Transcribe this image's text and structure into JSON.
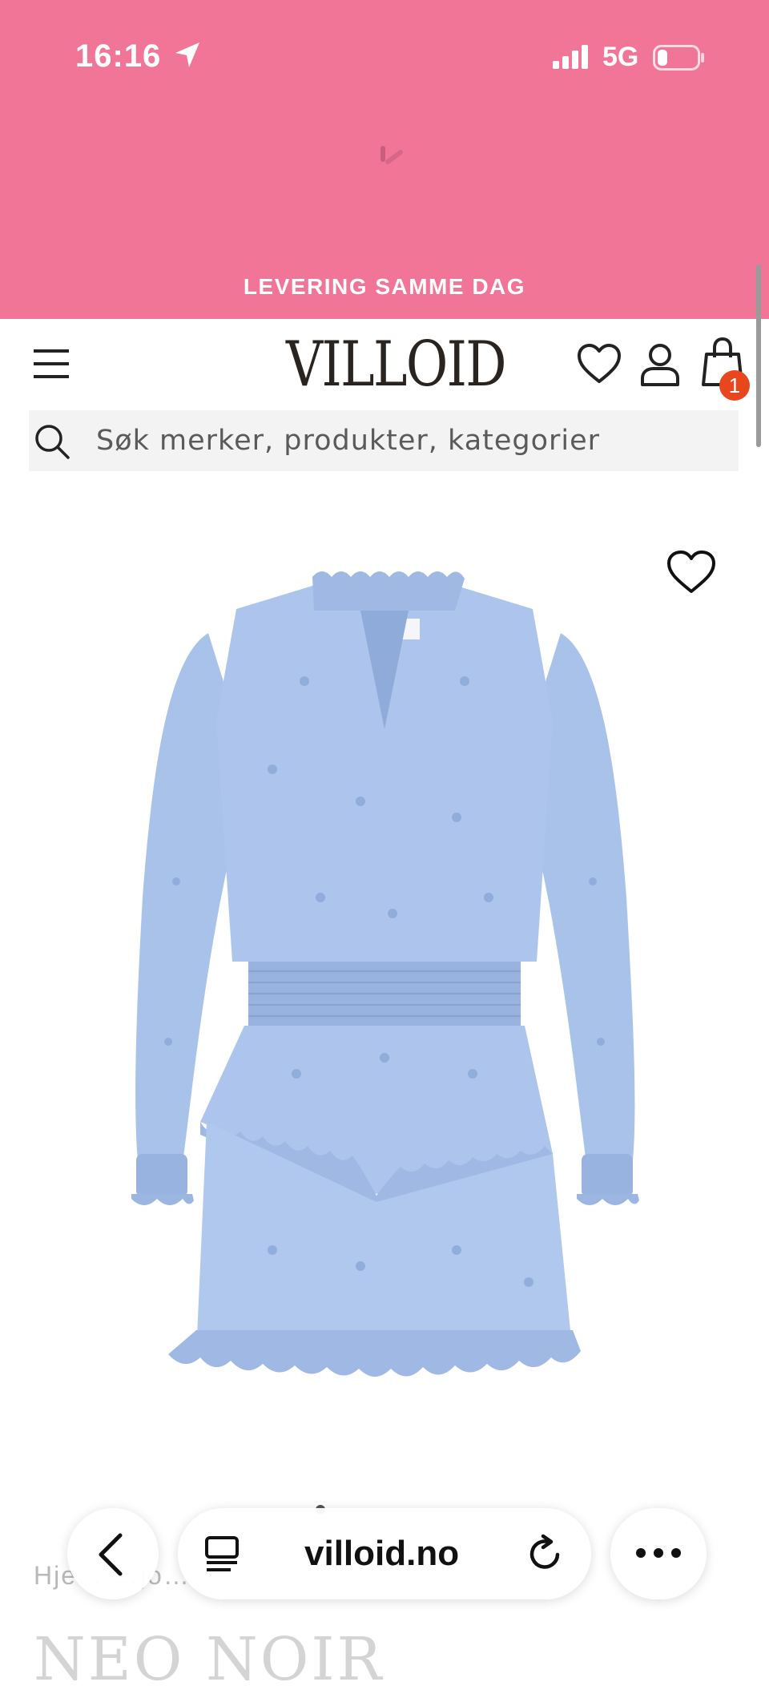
{
  "status_bar": {
    "time": "16:16",
    "network": "5G"
  },
  "promo": {
    "text": "LEVERING SAMME DAG"
  },
  "header": {
    "logo": "VILLOID",
    "cart_count": "1"
  },
  "search": {
    "placeholder": "Søk merker, produkter, kategorier"
  },
  "product": {
    "breadcrumb": "Hje… …jo…",
    "brand": "NEO NOIR"
  },
  "browser": {
    "url": "villoid.no"
  },
  "colors": {
    "promo_bg": "#f07597",
    "badge": "#e8461c",
    "dress": "#a7c0e8"
  },
  "icons": [
    "location-arrow-icon",
    "signal-icon",
    "battery-icon",
    "spinner-icon",
    "menu-icon",
    "heart-icon",
    "user-icon",
    "bag-icon",
    "search-icon",
    "favorite-icon",
    "back-icon",
    "tabs-icon",
    "reload-icon",
    "more-icon"
  ]
}
